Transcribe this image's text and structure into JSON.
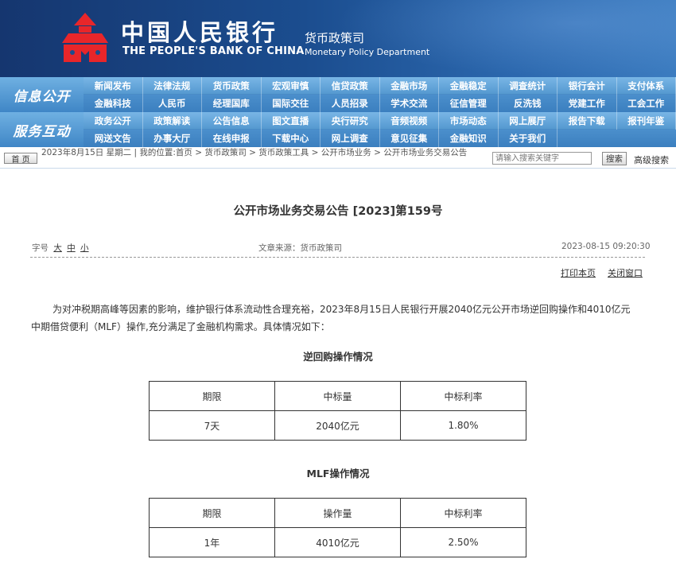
{
  "header": {
    "bank_cn": "中国人民银行",
    "bank_en": "THE PEOPLE'S BANK OF CHINA",
    "dept_cn": "货币政策司",
    "dept_en": "Monetary Policy Department",
    "logo_color": "#e8262a"
  },
  "nav": {
    "label1": "信息公开",
    "label2": "服务互动",
    "rows": [
      [
        "新闻发布",
        "法律法规",
        "货币政策",
        "宏观审慎",
        "信贷政策",
        "金融市场",
        "金融稳定",
        "调查统计",
        "银行会计",
        "支付体系"
      ],
      [
        "金融科技",
        "人民币",
        "经理国库",
        "国际交往",
        "人员招录",
        "学术交流",
        "征信管理",
        "反洗钱",
        "党建工作",
        "工会工作"
      ],
      [
        "政务公开",
        "政策解读",
        "公告信息",
        "图文直播",
        "央行研究",
        "音频视频",
        "市场动态",
        "网上展厅",
        "报告下载",
        "报刊年鉴"
      ],
      [
        "网送文告",
        "办事大厅",
        "在线申报",
        "下载中心",
        "网上调查",
        "意见征集",
        "金融知识",
        "关于我们"
      ]
    ]
  },
  "breadcrumb": {
    "home_label": "首 页",
    "text": "2023年8月15日 星期二 | 我的位置:首页 > 货币政策司 > 货币政策工具 > 公开市场业务 > 公开市场业务交易公告",
    "search_placeholder": "请输入搜索关键字",
    "search_button": "搜索",
    "advanced_search": "高级搜索"
  },
  "article": {
    "title": "公开市场业务交易公告 [2023]第159号",
    "font_size_label": "字号",
    "font_sizes": [
      "大",
      "中",
      "小"
    ],
    "source": "文章来源：货币政策司",
    "datetime": "2023-08-15 09:20:30",
    "print_link": "打印本页",
    "close_link": "关闭窗口",
    "para_line1": "为对冲税期高峰等因素的影响，维护银行体系流动性合理充裕，2023年8月15日人民银行开展2040亿元公开市场逆回购操作和4010亿元",
    "para_line2": "中期借贷便利（MLF）操作,充分满足了金融机构需求。具体情况如下：",
    "sec1_title": "逆回购操作情况",
    "table1": {
      "headers": [
        "期限",
        "中标量",
        "中标利率"
      ],
      "rows": [
        [
          "7天",
          "2040亿元",
          "1.80%"
        ]
      ]
    },
    "sec2_title": "MLF操作情况",
    "table2": {
      "headers": [
        "期限",
        "操作量",
        "中标利率"
      ],
      "rows": [
        [
          "1年",
          "4010亿元",
          "2.50%"
        ]
      ]
    }
  }
}
